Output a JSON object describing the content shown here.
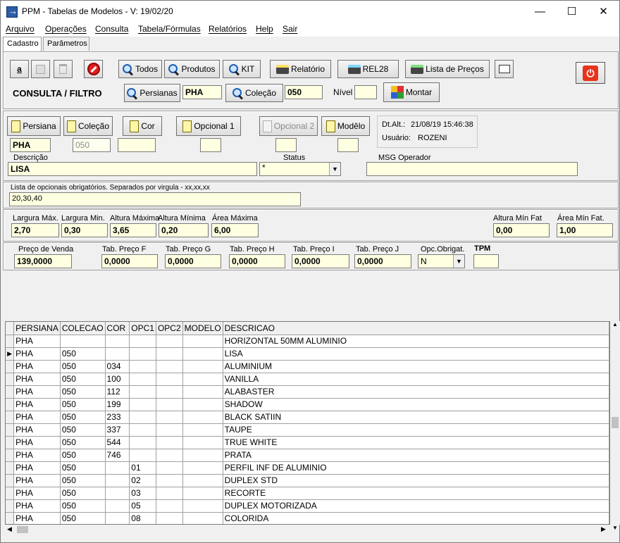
{
  "window": {
    "title": "PPM - Tabelas de Modelos - V: 19/02/20",
    "minimize": "—",
    "maximize": "☐",
    "close": "✕"
  },
  "menu": [
    "Arquivo",
    "Operações",
    "Consulta",
    "Tabela/Fórmulas",
    "Relatórios",
    "Help",
    "Sair"
  ],
  "tabs": [
    "Cadastro",
    "Parâmetros"
  ],
  "toolbar": {
    "todos": "Todos",
    "produtos": "Produtos",
    "kit": "KIT",
    "relatorio": "Relatório",
    "rel28": "REL28",
    "lista_precos": "Lista de Preços",
    "consulta_filtro": "CONSULTA / FILTRO",
    "persianas": "Persianas",
    "persianas_value": "PHA",
    "colecao": "Coleção",
    "colecao_value": "050",
    "nivel_label": "Nível",
    "nivel_value": "",
    "montar": "Montar"
  },
  "record": {
    "persiana_btn": "Persiana",
    "colecao_btn": "Coleção",
    "cor_btn": "Cor",
    "opcional1_btn": "Opcional 1",
    "opcional2_btn": "Opcional 2",
    "modelo_btn": "Modêlo",
    "persiana_value": "PHA",
    "colecao_value": "050",
    "cor_value": "",
    "opcional1_value": "",
    "opcional2_value": "",
    "modelo_value": "",
    "dtalt_label": "Dt.Alt.:",
    "dtalt_value": "21/08/19  15:46:38",
    "usuario_label": "Usuário:",
    "usuario_value": "ROZENI",
    "descricao_label": "Descrição",
    "descricao_value": "LISA",
    "status_label": "Status",
    "status_value": "*",
    "msg_label": "MSG Operador",
    "msg_value": "",
    "opcionais_label": "Lista de opcionais obrigatórios. Separados por virgula - xx,xx,xx",
    "opcionais_value": "20,30,40"
  },
  "dimensions": {
    "largura_max_label": "Largura Máx.",
    "largura_max": "2,70",
    "largura_min_label": "Largura Min.",
    "largura_min": "0,30",
    "altura_max_label": "Altura Máxima",
    "altura_max": "3,65",
    "altura_min_label": "Altura Mínima",
    "altura_min": "0,20",
    "area_max_label": "Área Máxima",
    "area_max": "6,00",
    "altura_min_fat_label": "Altura Mín Fat",
    "altura_min_fat": "0,00",
    "area_min_fat_label": "Área Mín Fat.",
    "area_min_fat": "1,00"
  },
  "prices": {
    "preco_venda_label": "Preço de Venda",
    "preco_venda": "139,0000",
    "tab_f_label": "Tab. Preço F",
    "tab_f": "0,0000",
    "tab_g_label": "Tab. Preço G",
    "tab_g": "0,0000",
    "tab_h_label": "Tab. Preço H",
    "tab_h": "0,0000",
    "tab_i_label": "Tab. Preço I",
    "tab_i": "0,0000",
    "tab_j_label": "Tab. Preço J",
    "tab_j": "0,0000",
    "opc_obrig_label": "Opc.Obrigat.",
    "opc_obrig": "N",
    "tpm_label": "TPM",
    "tpm": ""
  },
  "grid": {
    "columns": [
      "PERSIANA",
      "COLECAO",
      "COR",
      "OPC1",
      "OPC2",
      "MODELO",
      "DESCRICAO"
    ],
    "rows": [
      [
        "PHA",
        "",
        "",
        "",
        "",
        "",
        "HORIZONTAL 50MM ALUMINIO"
      ],
      [
        "PHA",
        "050",
        "",
        "",
        "",
        "",
        "LISA"
      ],
      [
        "PHA",
        "050",
        "034",
        "",
        "",
        "",
        "ALUMINIUM"
      ],
      [
        "PHA",
        "050",
        "100",
        "",
        "",
        "",
        "VANILLA"
      ],
      [
        "PHA",
        "050",
        "112",
        "",
        "",
        "",
        "ALABASTER"
      ],
      [
        "PHA",
        "050",
        "199",
        "",
        "",
        "",
        "SHADOW"
      ],
      [
        "PHA",
        "050",
        "233",
        "",
        "",
        "",
        "BLACK SATIIN"
      ],
      [
        "PHA",
        "050",
        "337",
        "",
        "",
        "",
        "TAUPE"
      ],
      [
        "PHA",
        "050",
        "544",
        "",
        "",
        "",
        "TRUE WHITE"
      ],
      [
        "PHA",
        "050",
        "746",
        "",
        "",
        "",
        "PRATA"
      ],
      [
        "PHA",
        "050",
        "",
        "01",
        "",
        "",
        "PERFIL INF DE ALUMINIO"
      ],
      [
        "PHA",
        "050",
        "",
        "02",
        "",
        "",
        "DUPLEX STD"
      ],
      [
        "PHA",
        "050",
        "",
        "03",
        "",
        "",
        "RECORTE"
      ],
      [
        "PHA",
        "050",
        "",
        "05",
        "",
        "",
        "DUPLEX MOTORIZADA"
      ],
      [
        "PHA",
        "050",
        "",
        "08",
        "",
        "",
        "COLORIDA"
      ]
    ],
    "selected_row": 1,
    "current_marker": "▶",
    "scroll_up": "▲",
    "scroll_down": "▼",
    "scroll_left": "◀",
    "scroll_right": "▶"
  }
}
